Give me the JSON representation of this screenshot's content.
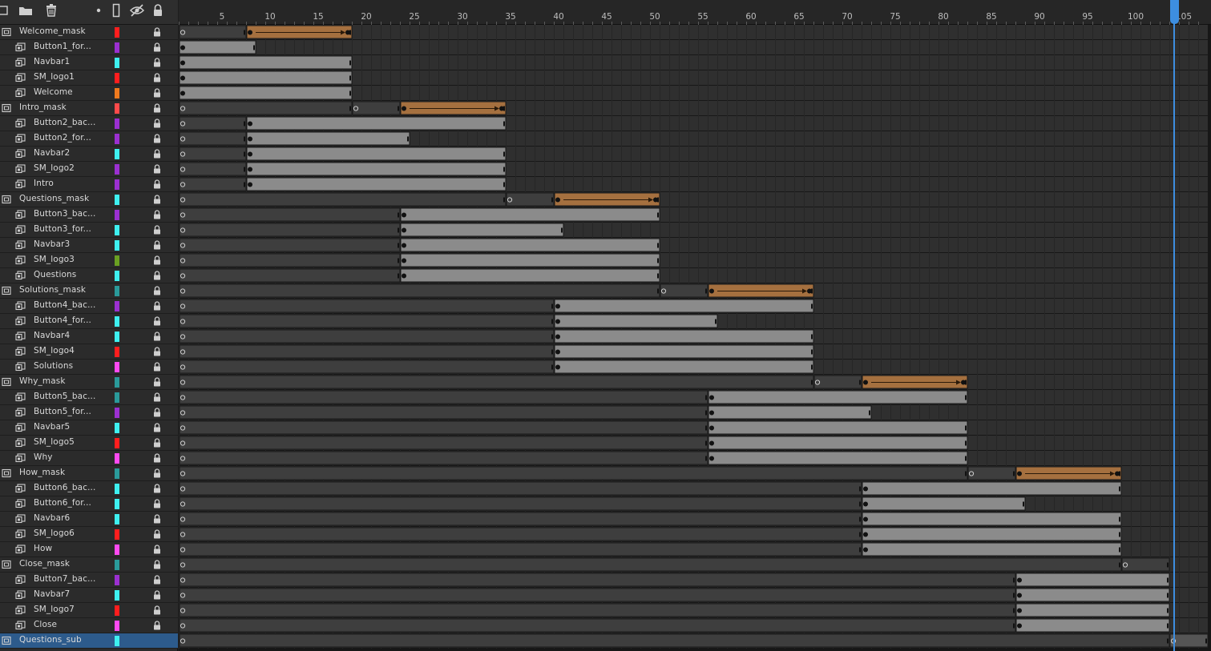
{
  "toolbar": {
    "icons": [
      "new-layer-icon",
      "new-folder-icon",
      "delete-icon",
      "highlight-dot-icon",
      "outline-icon",
      "visibility-icon",
      "lock-all-icon"
    ]
  },
  "timeline": {
    "total_frames": 107,
    "frame_width": 12,
    "ruler_labels": [
      "5",
      "10",
      "15",
      "20",
      "25",
      "30",
      "35",
      "40",
      "45",
      "50",
      "55",
      "60",
      "65",
      "70",
      "75",
      "80",
      "85",
      "90",
      "95",
      "100",
      "105"
    ],
    "playhead_frame": 104,
    "colors": {
      "empty": "#2f2f2f",
      "grid": "#262626",
      "dark_span": "#3e3e3e",
      "light_span": "#8b8b8b",
      "tween": "#a5703f",
      "keyframe": "#111111",
      "selected": "#2d5b8c",
      "playhead": "#3d8ee0"
    }
  },
  "layers": [
    {
      "name": "Welcome_mask",
      "type": "folder",
      "color": "#ff1e1e",
      "spans": [
        {
          "s": 1,
          "e": 7,
          "k": "dark"
        },
        {
          "s": 8,
          "e": 18,
          "k": "tween"
        }
      ]
    },
    {
      "name": "Button1_for...",
      "type": "child",
      "color": "#9b30d0",
      "spans": [
        {
          "s": 1,
          "e": 8,
          "k": "light"
        }
      ]
    },
    {
      "name": "Navbar1",
      "type": "child",
      "color": "#3ef0f0",
      "spans": [
        {
          "s": 1,
          "e": 18,
          "k": "light"
        }
      ]
    },
    {
      "name": "SM_logo1",
      "type": "child",
      "color": "#ff1e1e",
      "spans": [
        {
          "s": 1,
          "e": 18,
          "k": "light"
        }
      ]
    },
    {
      "name": "Welcome",
      "type": "child",
      "color": "#f07a1e",
      "spans": [
        {
          "s": 1,
          "e": 18,
          "k": "light"
        }
      ]
    },
    {
      "name": "Intro_mask",
      "type": "folder",
      "color": "#ff4a4a",
      "spans": [
        {
          "s": 1,
          "e": 18,
          "k": "dark"
        },
        {
          "s": 19,
          "e": 23,
          "k": "dark"
        },
        {
          "s": 24,
          "e": 34,
          "k": "tween"
        }
      ]
    },
    {
      "name": "Button2_bac...",
      "type": "child",
      "color": "#9b30d0",
      "spans": [
        {
          "s": 1,
          "e": 7,
          "k": "dark"
        },
        {
          "s": 8,
          "e": 34,
          "k": "light"
        }
      ]
    },
    {
      "name": "Button2_for...",
      "type": "child",
      "color": "#9b30d0",
      "spans": [
        {
          "s": 1,
          "e": 7,
          "k": "dark"
        },
        {
          "s": 8,
          "e": 24,
          "k": "light"
        }
      ]
    },
    {
      "name": "Navbar2",
      "type": "child",
      "color": "#3ef0f0",
      "spans": [
        {
          "s": 1,
          "e": 7,
          "k": "dark"
        },
        {
          "s": 8,
          "e": 34,
          "k": "light"
        }
      ]
    },
    {
      "name": "SM_logo2",
      "type": "child",
      "color": "#9b30d0",
      "spans": [
        {
          "s": 1,
          "e": 7,
          "k": "dark"
        },
        {
          "s": 8,
          "e": 34,
          "k": "light"
        }
      ]
    },
    {
      "name": "Intro",
      "type": "child",
      "color": "#9b30d0",
      "spans": [
        {
          "s": 1,
          "e": 7,
          "k": "dark"
        },
        {
          "s": 8,
          "e": 34,
          "k": "light"
        }
      ]
    },
    {
      "name": "Questions_mask",
      "type": "folder",
      "color": "#3ef0f0",
      "spans": [
        {
          "s": 1,
          "e": 34,
          "k": "dark"
        },
        {
          "s": 35,
          "e": 39,
          "k": "dark"
        },
        {
          "s": 40,
          "e": 50,
          "k": "tween"
        }
      ]
    },
    {
      "name": "Button3_bac...",
      "type": "child",
      "color": "#9b30d0",
      "spans": [
        {
          "s": 1,
          "e": 23,
          "k": "dark"
        },
        {
          "s": 24,
          "e": 50,
          "k": "light"
        }
      ]
    },
    {
      "name": "Button3_for...",
      "type": "child",
      "color": "#3ef0f0",
      "spans": [
        {
          "s": 1,
          "e": 23,
          "k": "dark"
        },
        {
          "s": 24,
          "e": 40,
          "k": "light"
        }
      ]
    },
    {
      "name": "Navbar3",
      "type": "child",
      "color": "#3ef0f0",
      "spans": [
        {
          "s": 1,
          "e": 23,
          "k": "dark"
        },
        {
          "s": 24,
          "e": 50,
          "k": "light"
        }
      ]
    },
    {
      "name": "SM_logo3",
      "type": "child",
      "color": "#6aa022",
      "spans": [
        {
          "s": 1,
          "e": 23,
          "k": "dark"
        },
        {
          "s": 24,
          "e": 50,
          "k": "light"
        }
      ]
    },
    {
      "name": "Questions",
      "type": "child",
      "color": "#3ef0f0",
      "spans": [
        {
          "s": 1,
          "e": 23,
          "k": "dark"
        },
        {
          "s": 24,
          "e": 50,
          "k": "light"
        }
      ]
    },
    {
      "name": "Solutions_mask",
      "type": "folder",
      "color": "#2a9a9a",
      "spans": [
        {
          "s": 1,
          "e": 50,
          "k": "dark"
        },
        {
          "s": 51,
          "e": 55,
          "k": "dark"
        },
        {
          "s": 56,
          "e": 66,
          "k": "tween"
        }
      ]
    },
    {
      "name": "Button4_bac...",
      "type": "child",
      "color": "#9b30d0",
      "spans": [
        {
          "s": 1,
          "e": 39,
          "k": "dark"
        },
        {
          "s": 40,
          "e": 66,
          "k": "light"
        }
      ]
    },
    {
      "name": "Button4_for...",
      "type": "child",
      "color": "#3ef0f0",
      "spans": [
        {
          "s": 1,
          "e": 39,
          "k": "dark"
        },
        {
          "s": 40,
          "e": 56,
          "k": "light"
        }
      ]
    },
    {
      "name": "Navbar4",
      "type": "child",
      "color": "#3ef0f0",
      "spans": [
        {
          "s": 1,
          "e": 39,
          "k": "dark"
        },
        {
          "s": 40,
          "e": 66,
          "k": "light"
        }
      ]
    },
    {
      "name": "SM_logo4",
      "type": "child",
      "color": "#ff1e1e",
      "spans": [
        {
          "s": 1,
          "e": 39,
          "k": "dark"
        },
        {
          "s": 40,
          "e": 66,
          "k": "light"
        }
      ]
    },
    {
      "name": "Solutions",
      "type": "child",
      "color": "#ff4af0",
      "spans": [
        {
          "s": 1,
          "e": 39,
          "k": "dark"
        },
        {
          "s": 40,
          "e": 66,
          "k": "light"
        }
      ]
    },
    {
      "name": "Why_mask",
      "type": "folder",
      "color": "#2a9a9a",
      "spans": [
        {
          "s": 1,
          "e": 66,
          "k": "dark"
        },
        {
          "s": 67,
          "e": 71,
          "k": "dark"
        },
        {
          "s": 72,
          "e": 82,
          "k": "tween"
        }
      ]
    },
    {
      "name": "Button5_bac...",
      "type": "child",
      "color": "#2a9a9a",
      "spans": [
        {
          "s": 1,
          "e": 55,
          "k": "dark"
        },
        {
          "s": 56,
          "e": 82,
          "k": "light"
        }
      ]
    },
    {
      "name": "Button5_for...",
      "type": "child",
      "color": "#9b30d0",
      "spans": [
        {
          "s": 1,
          "e": 55,
          "k": "dark"
        },
        {
          "s": 56,
          "e": 72,
          "k": "light"
        }
      ]
    },
    {
      "name": "Navbar5",
      "type": "child",
      "color": "#3ef0f0",
      "spans": [
        {
          "s": 1,
          "e": 55,
          "k": "dark"
        },
        {
          "s": 56,
          "e": 82,
          "k": "light"
        }
      ]
    },
    {
      "name": "SM_logo5",
      "type": "child",
      "color": "#ff1e1e",
      "spans": [
        {
          "s": 1,
          "e": 55,
          "k": "dark"
        },
        {
          "s": 56,
          "e": 82,
          "k": "light"
        }
      ]
    },
    {
      "name": "Why",
      "type": "child",
      "color": "#ff4af0",
      "spans": [
        {
          "s": 1,
          "e": 55,
          "k": "dark"
        },
        {
          "s": 56,
          "e": 82,
          "k": "light"
        }
      ]
    },
    {
      "name": "How_mask",
      "type": "folder",
      "color": "#2a9a9a",
      "spans": [
        {
          "s": 1,
          "e": 82,
          "k": "dark"
        },
        {
          "s": 83,
          "e": 87,
          "k": "dark"
        },
        {
          "s": 88,
          "e": 98,
          "k": "tween"
        }
      ]
    },
    {
      "name": "Button6_bac...",
      "type": "child",
      "color": "#3ef0f0",
      "spans": [
        {
          "s": 1,
          "e": 71,
          "k": "dark"
        },
        {
          "s": 72,
          "e": 98,
          "k": "light"
        }
      ]
    },
    {
      "name": "Button6_for...",
      "type": "child",
      "color": "#3ef0f0",
      "spans": [
        {
          "s": 1,
          "e": 71,
          "k": "dark"
        },
        {
          "s": 72,
          "e": 88,
          "k": "light"
        }
      ]
    },
    {
      "name": "Navbar6",
      "type": "child",
      "color": "#3ef0f0",
      "spans": [
        {
          "s": 1,
          "e": 71,
          "k": "dark"
        },
        {
          "s": 72,
          "e": 98,
          "k": "light"
        }
      ]
    },
    {
      "name": "SM_logo6",
      "type": "child",
      "color": "#ff1e1e",
      "spans": [
        {
          "s": 1,
          "e": 71,
          "k": "dark"
        },
        {
          "s": 72,
          "e": 98,
          "k": "light"
        }
      ]
    },
    {
      "name": "How",
      "type": "child",
      "color": "#ff4af0",
      "spans": [
        {
          "s": 1,
          "e": 71,
          "k": "dark"
        },
        {
          "s": 72,
          "e": 98,
          "k": "light"
        }
      ]
    },
    {
      "name": "Close_mask",
      "type": "folder",
      "color": "#2a9a9a",
      "spans": [
        {
          "s": 1,
          "e": 98,
          "k": "dark"
        },
        {
          "s": 99,
          "e": 103,
          "k": "dark"
        }
      ]
    },
    {
      "name": "Button7_bac...",
      "type": "child",
      "color": "#9b30d0",
      "spans": [
        {
          "s": 1,
          "e": 87,
          "k": "dark"
        },
        {
          "s": 88,
          "e": 103,
          "k": "light"
        }
      ]
    },
    {
      "name": "Navbar7",
      "type": "child",
      "color": "#3ef0f0",
      "spans": [
        {
          "s": 1,
          "e": 87,
          "k": "dark"
        },
        {
          "s": 88,
          "e": 103,
          "k": "light"
        }
      ]
    },
    {
      "name": "SM_logo7",
      "type": "child",
      "color": "#ff1e1e",
      "spans": [
        {
          "s": 1,
          "e": 87,
          "k": "dark"
        },
        {
          "s": 88,
          "e": 103,
          "k": "light"
        }
      ]
    },
    {
      "name": "Close",
      "type": "child",
      "color": "#ff4af0",
      "spans": [
        {
          "s": 1,
          "e": 87,
          "k": "dark"
        },
        {
          "s": 88,
          "e": 103,
          "k": "light"
        }
      ]
    },
    {
      "name": "Questions_sub",
      "type": "folder",
      "color": "#3ef0f0",
      "selected": true,
      "spans": [
        {
          "s": 1,
          "e": 103,
          "k": "dark"
        },
        {
          "s": 104,
          "e": 107,
          "k": "dark"
        }
      ]
    }
  ]
}
